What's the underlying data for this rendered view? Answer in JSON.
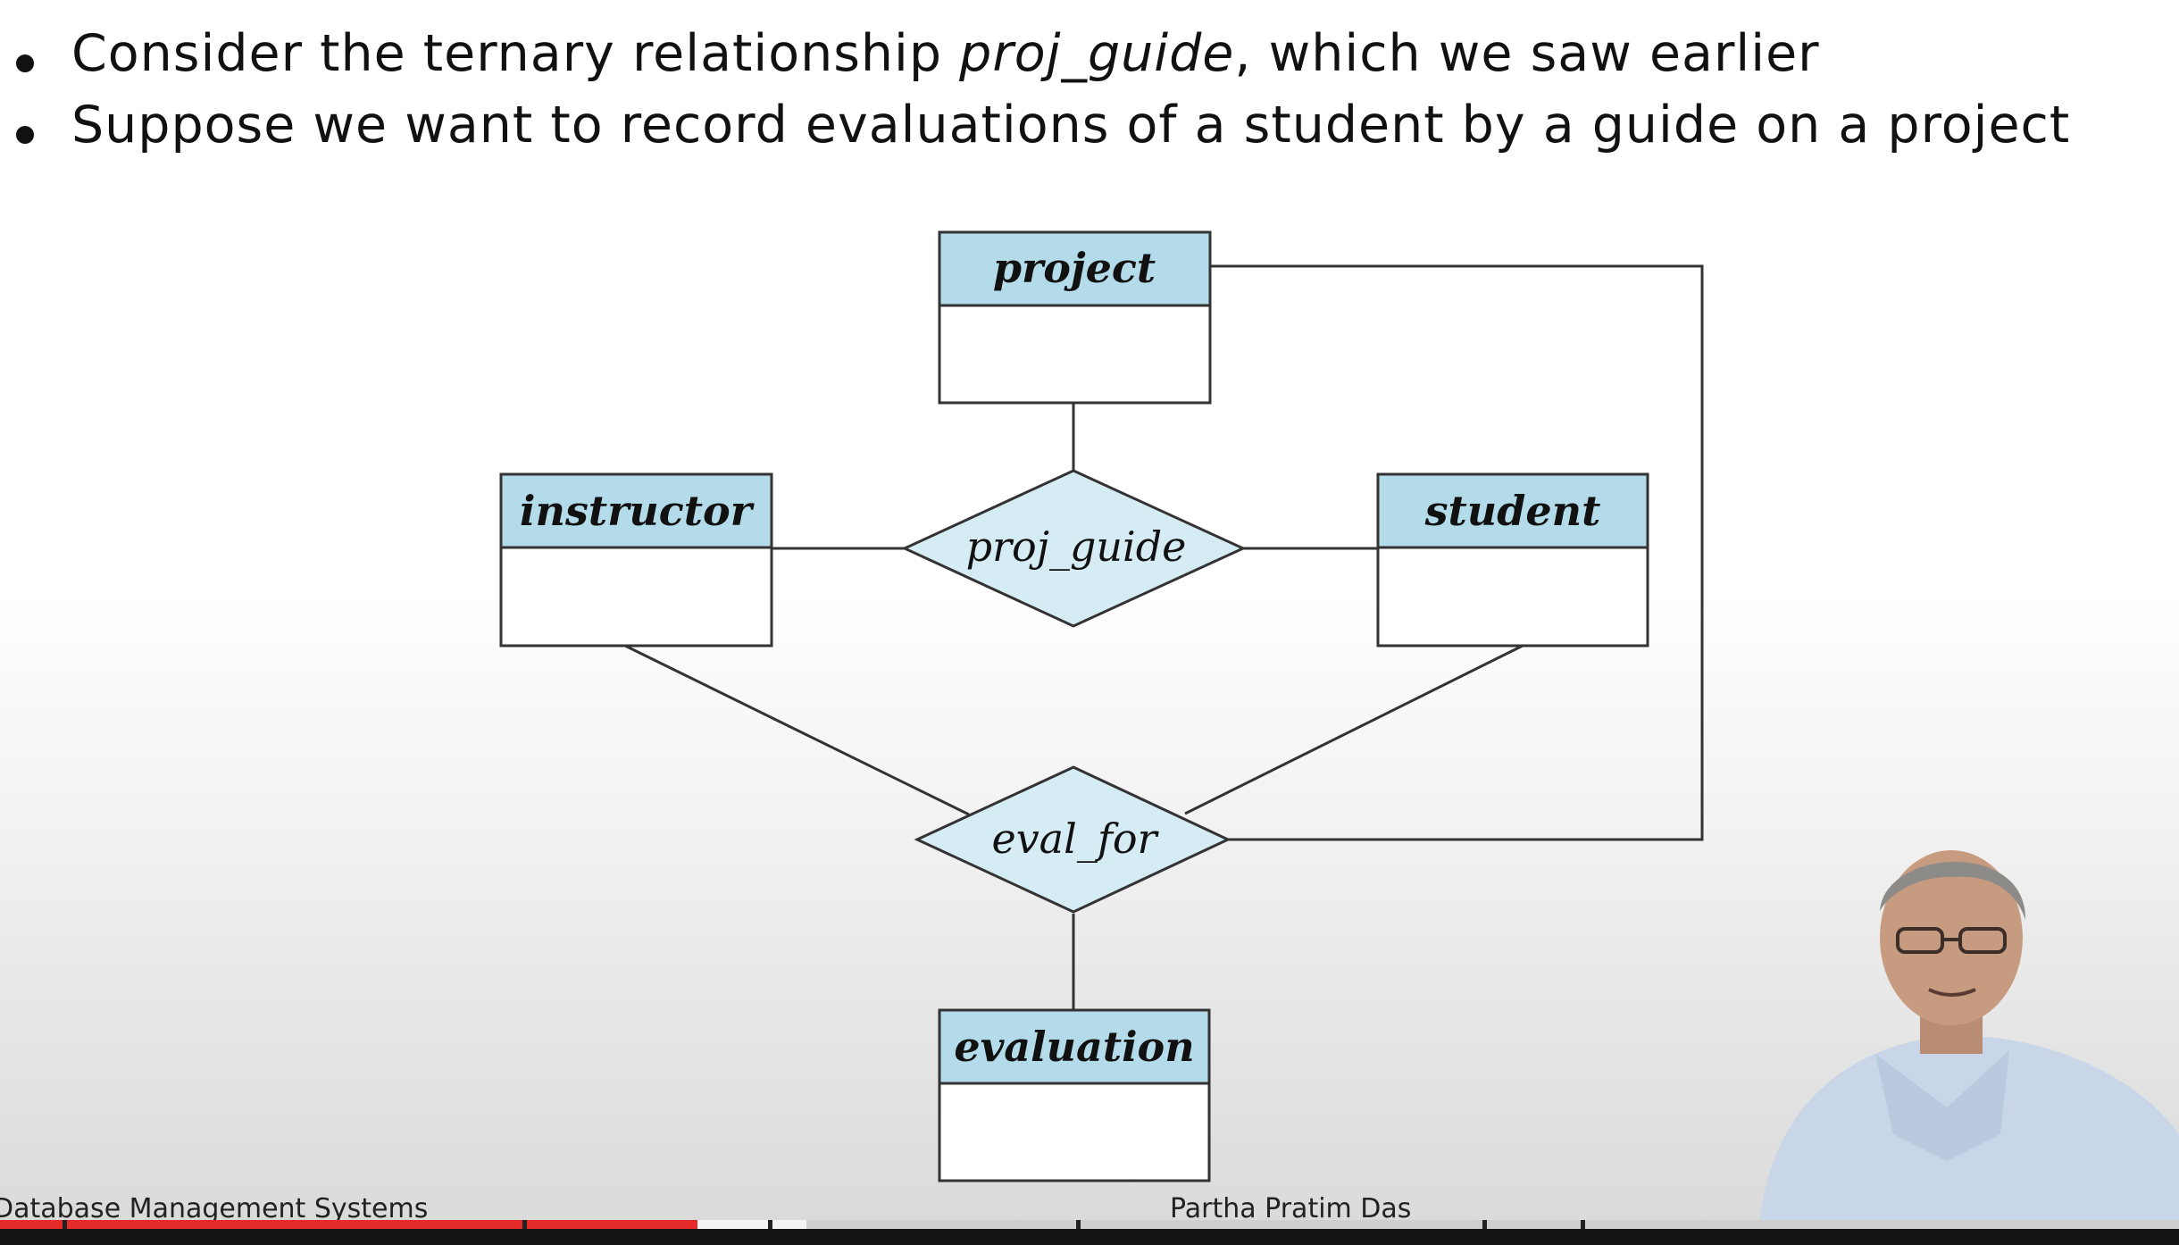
{
  "bullets": [
    {
      "before": "Consider the ternary relationship ",
      "italic": "proj_guide",
      "after": ", which we saw earlier"
    },
    {
      "text": "Suppose we want to record evaluations of a student by a guide on a project"
    }
  ],
  "diagram": {
    "entities": {
      "project": "project",
      "instructor": "instructor",
      "student": "student",
      "evaluation": "evaluation"
    },
    "relationships": {
      "proj_guide": "proj_guide",
      "eval_for": "eval_for"
    }
  },
  "footer": {
    "course": "Database Management Systems",
    "author": "Partha Pratim Das"
  },
  "video": {
    "progress_fraction": 0.32,
    "buffered_fraction": 0.37
  },
  "colors": {
    "entity_header": "#b4dbe9",
    "relationship_fill": "#d6ecf4",
    "progress": "#e52a2a"
  }
}
